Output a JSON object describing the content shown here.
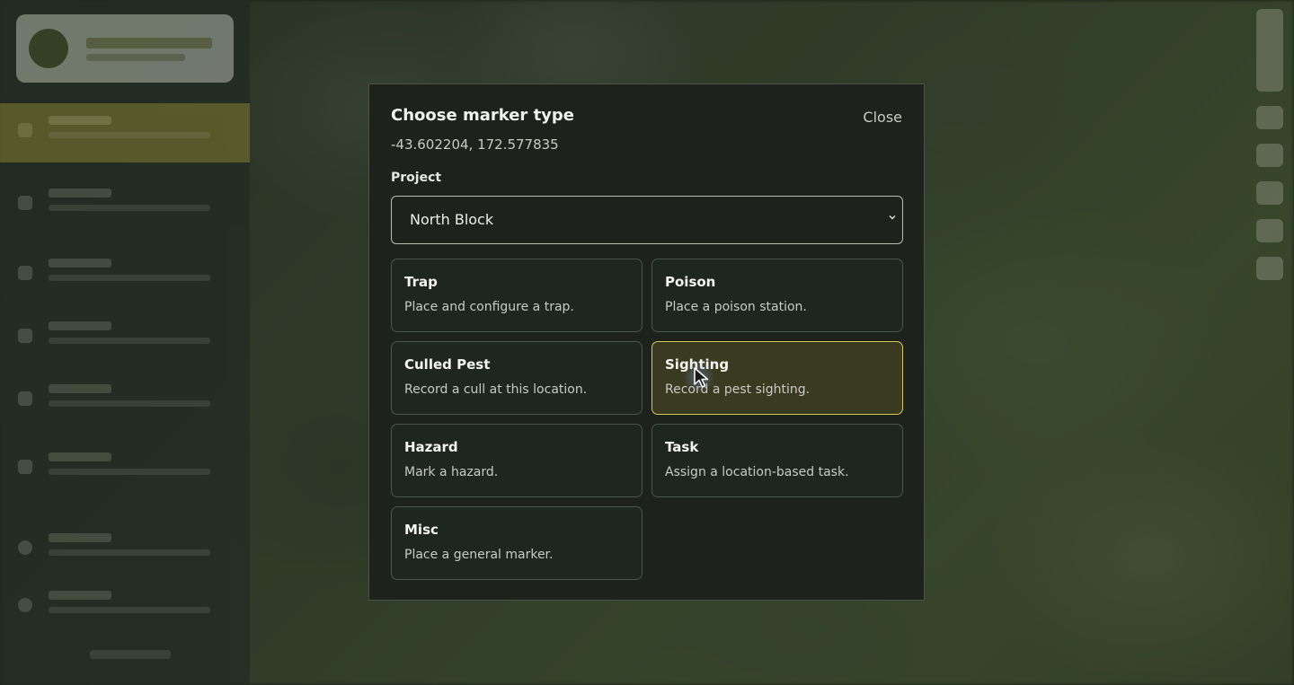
{
  "modal": {
    "title": "Choose marker type",
    "close_label": "Close",
    "coordinates": "-43.602204, 172.577835",
    "project_label": "Project",
    "project_value": "North Block"
  },
  "marker_types": [
    {
      "title": "Trap",
      "description": "Place and configure a trap.",
      "selected": false
    },
    {
      "title": "Poison",
      "description": "Place a poison station.",
      "selected": false
    },
    {
      "title": "Culled Pest",
      "description": "Record a cull at this location.",
      "selected": false
    },
    {
      "title": "Sighting",
      "description": "Record a pest sighting.",
      "selected": true
    },
    {
      "title": "Hazard",
      "description": "Mark a hazard.",
      "selected": false
    },
    {
      "title": "Task",
      "description": "Assign a location-based task.",
      "selected": false
    },
    {
      "title": "Misc",
      "description": "Place a general marker.",
      "selected": false
    }
  ],
  "colors": {
    "modal_bg": "#1d221d",
    "selected_card_bg": "#3a3a20",
    "selected_card_border": "#d8c85a",
    "sidebar_active": "#6e6a2f"
  },
  "icons": {
    "select_chevron": "chevron-down-icon",
    "pointer": "mouse-cursor-icon"
  }
}
